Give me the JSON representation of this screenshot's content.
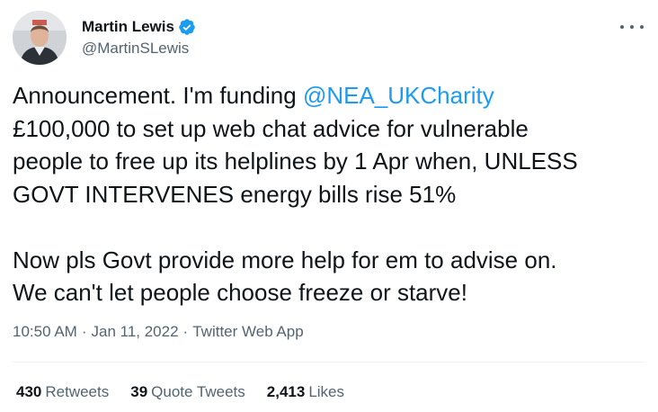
{
  "author": {
    "display_name": "Martin Lewis",
    "handle": "@MartinSLewis",
    "verified_icon": "verified-badge-icon",
    "accent": "#1d9bf0"
  },
  "tweet": {
    "text_before_mention": "Announcement. I'm funding ",
    "mention": "@NEA_UKCharity",
    "text_after_mention": "\n£100,000 to set up web chat advice for vulnerable\npeople to free up its helplines by 1 Apr when, UNLESS\nGOVT INTERVENES energy bills rise 51%\n\nNow pls Govt provide more help for em to advise on.\nWe can't let people choose freeze or starve!"
  },
  "meta": {
    "time": "10:50 AM",
    "separator": "·",
    "date": "Jan 11, 2022",
    "source": "Twitter Web App"
  },
  "stats": [
    {
      "count": "430",
      "label": "Retweets"
    },
    {
      "count": "39",
      "label": "Quote Tweets"
    },
    {
      "count": "2,413",
      "label": "Likes"
    }
  ],
  "colors": {
    "text": "#0f1419",
    "secondary": "#536471",
    "link": "#1d9bf0",
    "divider": "#eff3f4"
  }
}
